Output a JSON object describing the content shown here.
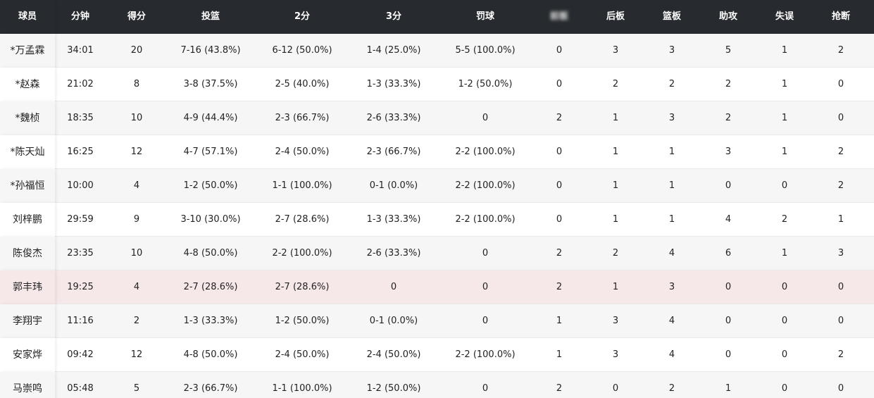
{
  "colors": {
    "header_bg": "#272b2f",
    "header_text": "#ffffff",
    "row_odd": "#f6f6f6",
    "row_even": "#ffffff",
    "row_highlight": "#f6e8e9",
    "text": "#222222"
  },
  "table": {
    "columns": [
      {
        "key": "player",
        "label": "球员"
      },
      {
        "key": "minutes",
        "label": "分钟"
      },
      {
        "key": "points",
        "label": "得分"
      },
      {
        "key": "fg",
        "label": "投篮"
      },
      {
        "key": "two",
        "label": "2分"
      },
      {
        "key": "three",
        "label": "3分"
      },
      {
        "key": "ft",
        "label": "罚球"
      },
      {
        "key": "oreb",
        "label": "前板",
        "obscured": true
      },
      {
        "key": "dreb",
        "label": "后板"
      },
      {
        "key": "reb",
        "label": "篮板"
      },
      {
        "key": "ast",
        "label": "助攻"
      },
      {
        "key": "tov",
        "label": "失误"
      },
      {
        "key": "stl",
        "label": "抢断"
      }
    ],
    "highlight_row": 7,
    "rows": [
      [
        "*万孟霖",
        "34:01",
        "20",
        "7-16 (43.8%)",
        "6-12 (50.0%)",
        "1-4 (25.0%)",
        "5-5 (100.0%)",
        "0",
        "3",
        "3",
        "5",
        "1",
        "2"
      ],
      [
        "*赵森",
        "21:02",
        "8",
        "3-8 (37.5%)",
        "2-5 (40.0%)",
        "1-3 (33.3%)",
        "1-2 (50.0%)",
        "0",
        "2",
        "2",
        "2",
        "1",
        "0"
      ],
      [
        "*魏桢",
        "18:35",
        "10",
        "4-9 (44.4%)",
        "2-3 (66.7%)",
        "2-6 (33.3%)",
        "0",
        "2",
        "1",
        "3",
        "2",
        "1",
        "0"
      ],
      [
        "*陈天灿",
        "16:25",
        "12",
        "4-7 (57.1%)",
        "2-4 (50.0%)",
        "2-3 (66.7%)",
        "2-2 (100.0%)",
        "0",
        "1",
        "1",
        "3",
        "1",
        "2"
      ],
      [
        "*孙福恒",
        "10:00",
        "4",
        "1-2 (50.0%)",
        "1-1 (100.0%)",
        "0-1 (0.0%)",
        "2-2 (100.0%)",
        "0",
        "1",
        "1",
        "0",
        "0",
        "2"
      ],
      [
        "刘梓鹏",
        "29:59",
        "9",
        "3-10 (30.0%)",
        "2-7 (28.6%)",
        "1-3 (33.3%)",
        "2-2 (100.0%)",
        "0",
        "1",
        "1",
        "4",
        "2",
        "1"
      ],
      [
        "陈俊杰",
        "23:35",
        "10",
        "4-8 (50.0%)",
        "2-2 (100.0%)",
        "2-6 (33.3%)",
        "0",
        "2",
        "2",
        "4",
        "6",
        "1",
        "3"
      ],
      [
        "郭丰玮",
        "19:25",
        "4",
        "2-7 (28.6%)",
        "2-7 (28.6%)",
        "0",
        "0",
        "2",
        "1",
        "3",
        "0",
        "0",
        "0"
      ],
      [
        "李翔宇",
        "11:16",
        "2",
        "1-3 (33.3%)",
        "1-2 (50.0%)",
        "0-1 (0.0%)",
        "0",
        "1",
        "3",
        "4",
        "0",
        "0",
        "0"
      ],
      [
        "安家烨",
        "09:42",
        "12",
        "4-8 (50.0%)",
        "2-4 (50.0%)",
        "2-4 (50.0%)",
        "2-2 (100.0%)",
        "1",
        "3",
        "4",
        "0",
        "0",
        "2"
      ],
      [
        "马崇鸣",
        "05:48",
        "5",
        "2-3 (66.7%)",
        "1-1 (100.0%)",
        "1-2 (50.0%)",
        "0",
        "2",
        "0",
        "2",
        "1",
        "0",
        "0"
      ]
    ]
  }
}
